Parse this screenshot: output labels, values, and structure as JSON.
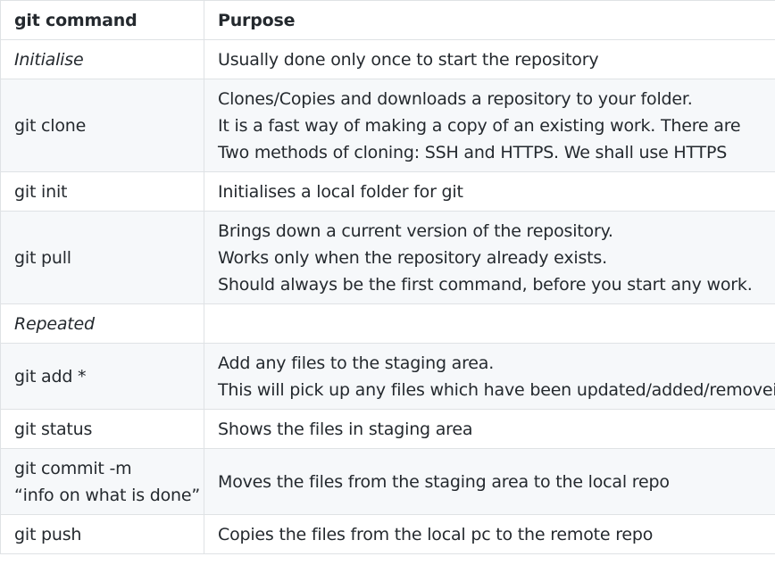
{
  "table": {
    "headers": [
      "git command",
      "Purpose"
    ],
    "rows": [
      {
        "command": [
          "Initialise"
        ],
        "purpose": [
          "Usually done only once to start the repository"
        ]
      },
      {
        "command": [
          "git clone"
        ],
        "purpose": [
          "Clones/Copies and downloads a repository to your folder.",
          "It is a fast way of making a copy of an existing work. There are",
          "Two methods of cloning: SSH and HTTPS. We shall use HTTPS"
        ]
      },
      {
        "command": [
          "git init"
        ],
        "purpose": [
          "Initialises a local folder for git"
        ]
      },
      {
        "command": [
          "git pull"
        ],
        "purpose": [
          "Brings down a current version of the repository.",
          "Works only when the repository already exists.",
          "Should always be the first command, before you start any work."
        ]
      },
      {
        "command": [
          "Repeated"
        ],
        "purpose": [
          ""
        ]
      },
      {
        "command": [
          "git add *"
        ],
        "purpose": [
          "Add any files to the staging area.",
          "This will pick up any files which have been updated/added/removeid."
        ]
      },
      {
        "command": [
          "git status"
        ],
        "purpose": [
          "Shows the files in staging area"
        ]
      },
      {
        "command": [
          "git commit -m",
          "“info on what is done”"
        ],
        "purpose": [
          "Moves the files from the staging area to the local repo"
        ]
      },
      {
        "command": [
          "git push"
        ],
        "purpose": [
          "Copies the files from the local pc to the remote repo"
        ]
      }
    ]
  }
}
